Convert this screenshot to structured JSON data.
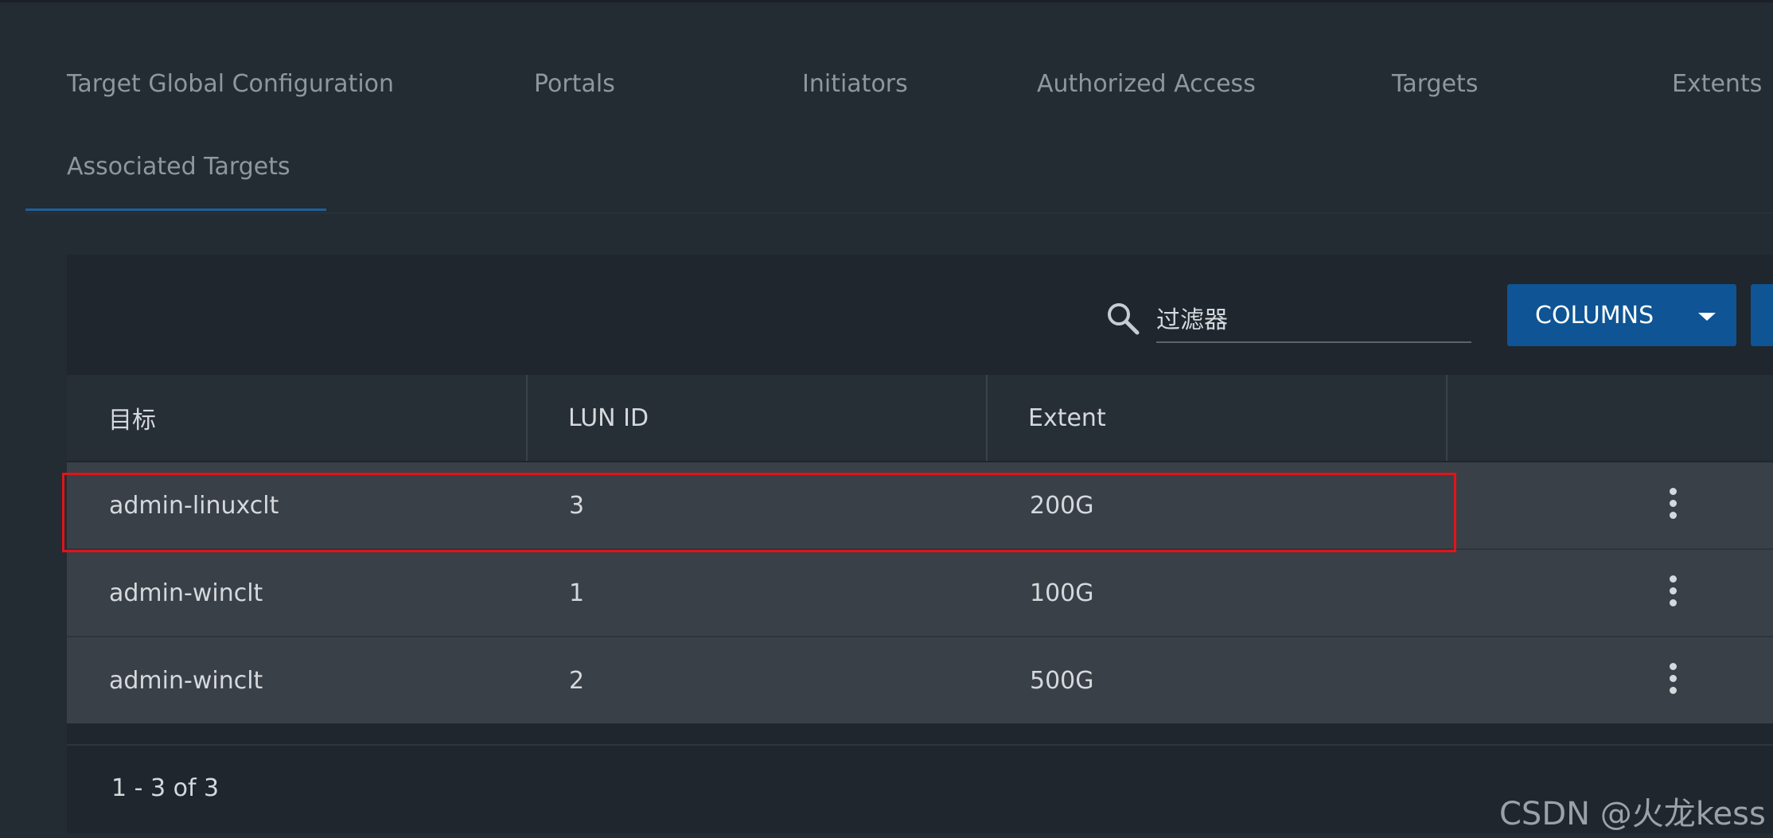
{
  "tabs": [
    {
      "label": "Target Global Configuration",
      "active": false
    },
    {
      "label": "Portals",
      "active": false
    },
    {
      "label": "Initiators",
      "active": false
    },
    {
      "label": "Authorized Access",
      "active": false
    },
    {
      "label": "Targets",
      "active": false
    },
    {
      "label": "Extents",
      "active": false
    },
    {
      "label": "Associated Targets",
      "active": true
    }
  ],
  "toolbar": {
    "search_icon": "search-icon",
    "filter_placeholder": "过滤器",
    "columns_label": "COLUMNS",
    "columns_icon": "caret-down-icon"
  },
  "table": {
    "columns": [
      "目标",
      "LUN ID",
      "Extent",
      ""
    ],
    "rows": [
      {
        "target": "admin-linuxclt",
        "lun_id": "3",
        "extent": "200G",
        "highlighted": true
      },
      {
        "target": "admin-winclt",
        "lun_id": "1",
        "extent": "100G",
        "highlighted": false
      },
      {
        "target": "admin-winclt",
        "lun_id": "2",
        "extent": "500G",
        "highlighted": false
      }
    ],
    "row_action_icon": "kebab-menu-icon"
  },
  "footer": {
    "count_text": "1 - 3 of 3"
  },
  "watermark": "CSDN @火龙kess",
  "colors": {
    "background": "#232b33",
    "primary_button": "#0f5494",
    "active_tab_underline": "#1f5f96",
    "highlight_border": "#e0141a"
  }
}
